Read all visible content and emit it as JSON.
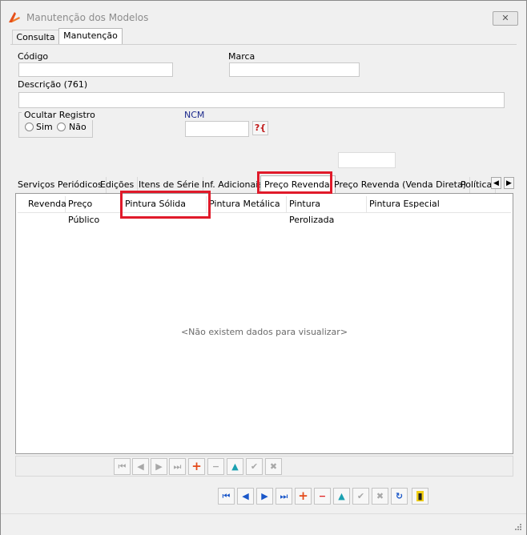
{
  "window": {
    "title": "Manutenção dos Modelos",
    "close_label": "✕"
  },
  "main_tabs": [
    {
      "label": "Consulta",
      "active": false
    },
    {
      "label": "Manutenção",
      "active": true
    }
  ],
  "form": {
    "codigo_label": "Código",
    "codigo_value": "",
    "marca_label": "Marca",
    "marca_value": "",
    "descricao_label": "Descrição (761)",
    "descricao_value": "",
    "ocultar_label": "Ocultar Registro",
    "sim_label": "Sim",
    "nao_label": "Não",
    "ncm_label": "NCM",
    "ncm_value": "",
    "help_label": "?{"
  },
  "sub_tabs": [
    {
      "label": "Serviços Periódicos",
      "active": false
    },
    {
      "label": "Edições",
      "active": false
    },
    {
      "label": "Itens de Série",
      "active": false
    },
    {
      "label": "Inf. Adicionais",
      "active": false
    },
    {
      "label": "Preço Revenda",
      "active": true
    },
    {
      "label": "Preço Revenda (Venda Direta)",
      "active": false
    },
    {
      "label": "Política",
      "active": false
    }
  ],
  "grid": {
    "columns": [
      "Revenda",
      "Preço Público",
      "Pintura Sólida",
      "Pintura Metálica",
      "Pintura Perolizada",
      "Pintura Especial"
    ],
    "empty_message": "<Não existem dados para visualizar>"
  },
  "icons": {
    "first": "⏮",
    "prev": "◀",
    "next": "▶",
    "last": "⏭",
    "add": "+",
    "remove": "−",
    "up": "▲",
    "confirm": "✔",
    "cancel": "✖",
    "refresh": "↻",
    "exit": "▮"
  },
  "colors": {
    "highlight": "#e01a2a",
    "accent_blue": "#1a57c9",
    "add_orange": "#e44a1a"
  }
}
